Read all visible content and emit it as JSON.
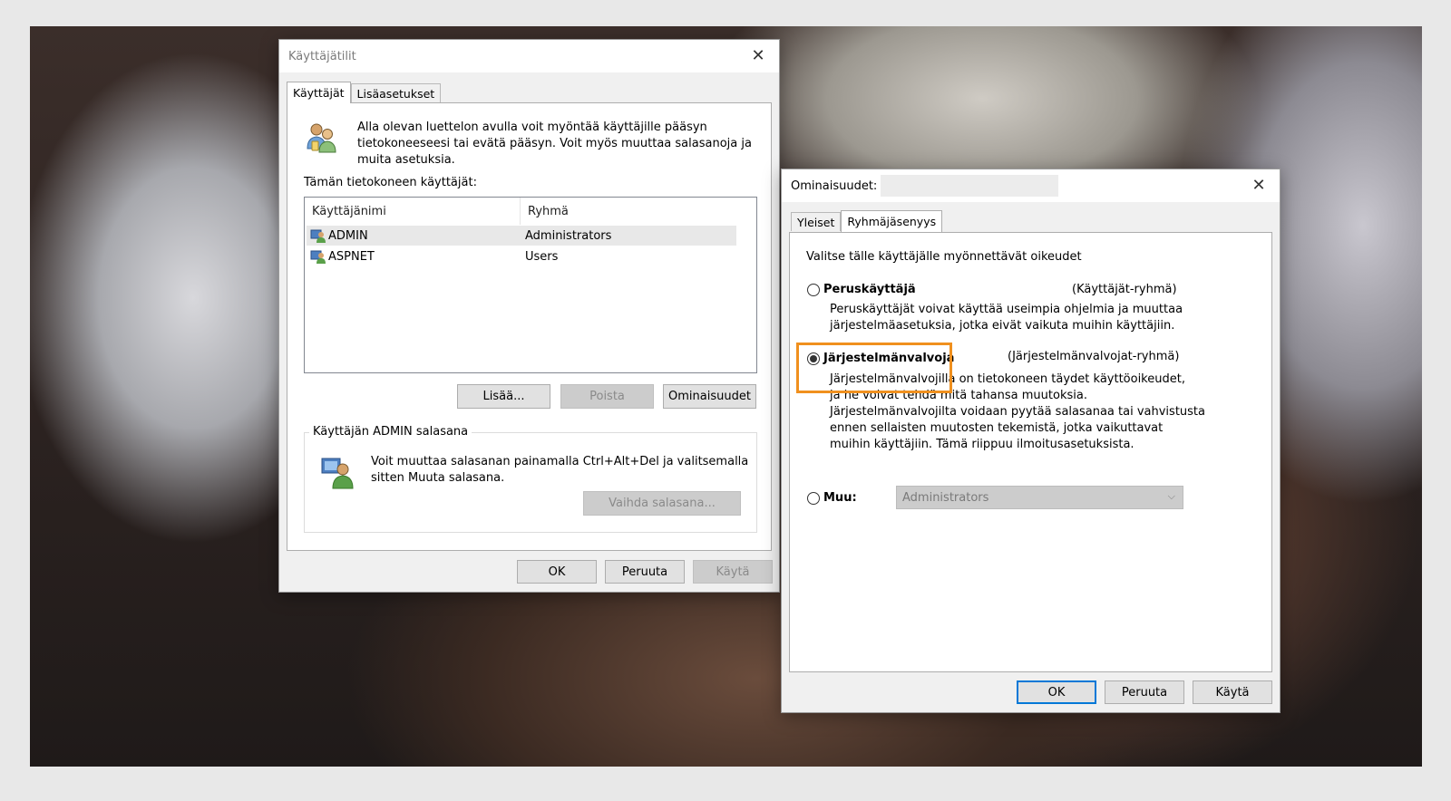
{
  "accounts_dialog": {
    "title": "Käyttäjätilit",
    "tabs": [
      {
        "label": "Käyttäjät",
        "active": true
      },
      {
        "label": "Lisäasetukset",
        "active": false
      }
    ],
    "intro_lines": [
      "Alla olevan luettelon avulla voit myöntää käyttäjille pääsyn",
      "tietokoneeseesi tai evätä pääsyn. Voit myös muuttaa salasanoja ja",
      "muita asetuksia."
    ],
    "users_label": "Tämän tietokoneen käyttäjät:",
    "columns": [
      "Käyttäjänimi",
      "Ryhmä"
    ],
    "rows": [
      {
        "username": "ADMIN",
        "group": "Administrators",
        "selected": true
      },
      {
        "username": "ASPNET",
        "group": "Users",
        "selected": false
      }
    ],
    "buttons": {
      "add": "Lisää...",
      "remove": "Poista",
      "properties": "Ominaisuudet"
    },
    "password_group": {
      "label": "Käyttäjän ADMIN salasana",
      "lines": [
        "Voit muuttaa salasanan painamalla Ctrl+Alt+Del ja valitsemalla",
        "sitten Muuta salasana."
      ],
      "button": "Vaihda salasana..."
    },
    "footer": {
      "ok": "OK",
      "cancel": "Peruuta",
      "apply": "Käytä"
    }
  },
  "properties_dialog": {
    "title": "Ominaisuudet:",
    "tabs": [
      {
        "label": "Yleiset",
        "active": false
      },
      {
        "label": "Ryhmäjäsenyys",
        "active": true
      }
    ],
    "heading": "Valitse tälle käyttäjälle myönnettävät oikeudet",
    "options": [
      {
        "label": "Peruskäyttäjä",
        "group_hint": "(Käyttäjät-ryhmä)",
        "selected": false,
        "lines": [
          "Peruskäyttäjät voivat käyttää useimpia ohjelmia ja muuttaa",
          "järjestelmäasetuksia, jotka eivät vaikuta muihin käyttäjiin."
        ]
      },
      {
        "label": "Järjestelmänvalvoja",
        "group_hint": "(Järjestelmänvalvojat-ryhmä)",
        "selected": true,
        "lines": [
          "Järjestelmänvalvojilla on tietokoneen täydet käyttöoikeudet,",
          "ja he voivat tehdä mitä tahansa muutoksia.",
          "Järjestelmänvalvojilta voidaan pyytää salasanaa tai vahvistusta",
          "ennen sellaisten muutosten tekemistä, jotka vaikuttavat",
          "muihin käyttäjiin. Tämä riippuu ilmoitusasetuksista."
        ]
      },
      {
        "label": "Muu:",
        "selected": false,
        "select_value": "Administrators"
      }
    ],
    "footer": {
      "ok": "OK",
      "cancel": "Peruuta",
      "apply": "Käytä"
    }
  },
  "colors": {
    "highlight": "#f0901e",
    "focus": "#0078d7"
  }
}
